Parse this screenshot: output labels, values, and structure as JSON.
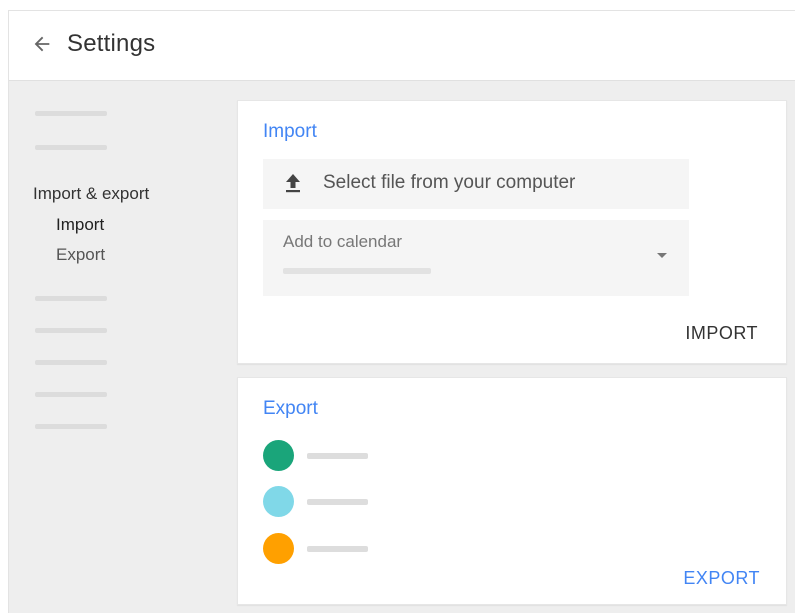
{
  "header": {
    "back_icon": "arrow-back-icon",
    "title": "Settings"
  },
  "sidebar": {
    "section_heading": "Import & export",
    "items": [
      {
        "label": "Import",
        "active": true
      },
      {
        "label": "Export",
        "active": false
      }
    ]
  },
  "import_card": {
    "title": "Import",
    "file_select": {
      "icon": "upload-icon",
      "label": "Select file from your computer"
    },
    "calendar_select": {
      "label": "Add to calendar",
      "icon": "chevron-down-icon"
    },
    "button_label": "IMPORT"
  },
  "export_card": {
    "title": "Export",
    "calendars": [
      {
        "color": "#1aa57a"
      },
      {
        "color": "#80d8e8"
      },
      {
        "color": "#ffa000"
      }
    ],
    "button_label": "EXPORT"
  },
  "colors": {
    "accent": "#4285f4",
    "background": "#eeeeee",
    "card": "#ffffff"
  }
}
